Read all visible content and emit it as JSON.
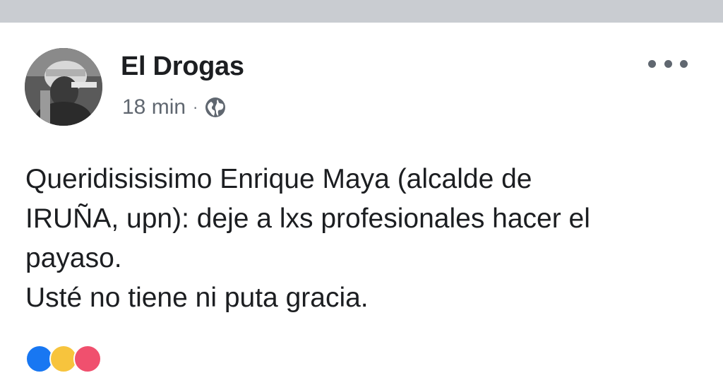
{
  "post": {
    "author": "El Drogas",
    "time": "18 min",
    "separator": "·",
    "privacy_icon": "globe-icon",
    "menu_icon": "more-options-icon",
    "lines": [
      "Queridisisisimo Enrique Maya (alcalde de",
      "IRUÑA, upn): deje a lxs profesionales hacer el",
      "payaso.",
      "Usté no tiene ni puta gracia."
    ]
  },
  "reactions": {
    "icons": [
      "like-icon",
      "haha-icon",
      "love-icon"
    ]
  }
}
